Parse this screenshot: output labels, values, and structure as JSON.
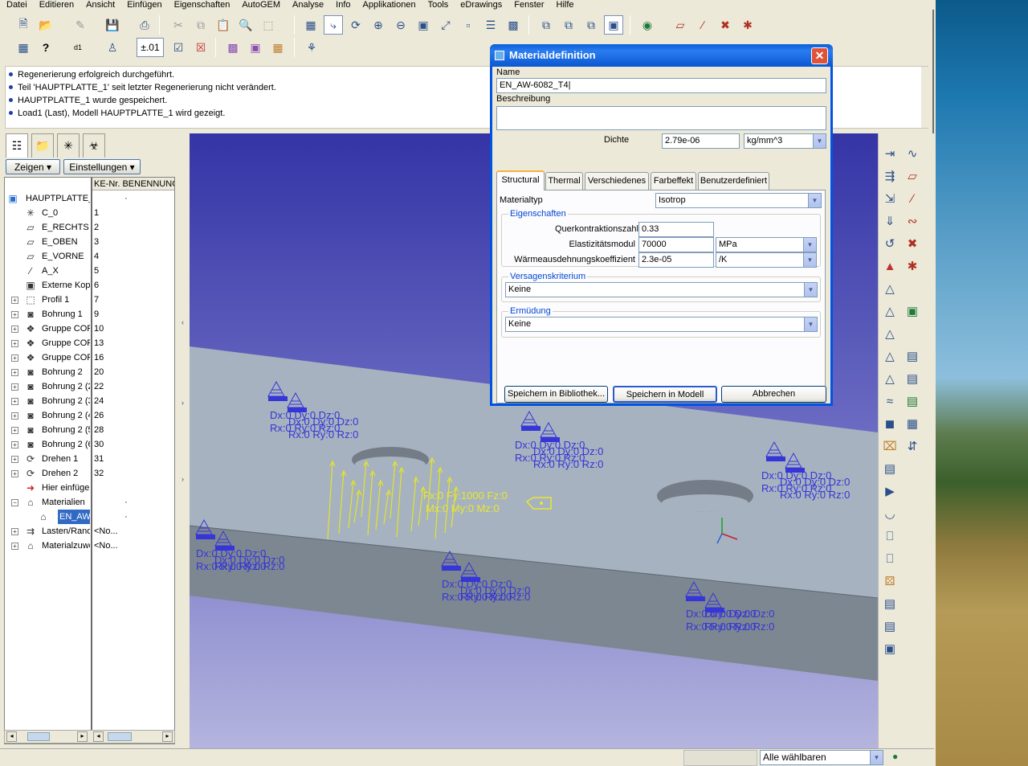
{
  "menu": [
    "Datei",
    "Editieren",
    "Ansicht",
    "Einfügen",
    "Eigenschaften",
    "AutoGEM",
    "Analyse",
    "Info",
    "Applikationen",
    "Tools",
    "eDrawings",
    "Fenster",
    "Hilfe"
  ],
  "toolbar": {
    "precision_label": "±.01"
  },
  "messages": [
    "Regenerierung erfolgreich durchgeführt.",
    "Teil 'HAUPTPLATTE_1' seit letzter Regenerierung nicht verändert.",
    "HAUPTPLATTE_1 wurde gespeichert.",
    "Load1 (Last), Modell HAUPTPLATTE_1 wird gezeigt."
  ],
  "tree": {
    "show_button": "Zeigen",
    "settings_button": "Einstellungen",
    "columns": {
      "ke_nr": "KE-Nr.",
      "name": "BENENNUNG"
    },
    "root": "HAUPTPLATTE_",
    "rows": [
      {
        "name": "C_0",
        "no": "1",
        "icon": "coordinate-system-icon",
        "exp": false
      },
      {
        "name": "E_RECHTS",
        "no": "2",
        "icon": "datum-plane-icon",
        "exp": false
      },
      {
        "name": "E_OBEN",
        "no": "3",
        "icon": "datum-plane-icon",
        "exp": false
      },
      {
        "name": "E_VORNE",
        "no": "4",
        "icon": "datum-plane-icon",
        "exp": false
      },
      {
        "name": "A_X",
        "no": "5",
        "icon": "datum-axis-icon",
        "exp": false
      },
      {
        "name": "Externe Kop",
        "no": "6",
        "icon": "external-copy-icon",
        "exp": false
      },
      {
        "name": "Profil 1",
        "no": "7",
        "icon": "profile-icon",
        "exp": true
      },
      {
        "name": "Bohrung 1",
        "no": "9",
        "icon": "hole-icon",
        "exp": true
      },
      {
        "name": "Gruppe COF",
        "no": "10",
        "icon": "group-icon",
        "exp": true
      },
      {
        "name": "Gruppe COF",
        "no": "13",
        "icon": "group-icon",
        "exp": true
      },
      {
        "name": "Gruppe COF",
        "no": "16",
        "icon": "group-icon",
        "exp": true
      },
      {
        "name": "Bohrung 2",
        "no": "20",
        "icon": "hole-icon",
        "exp": true
      },
      {
        "name": "Bohrung 2 (2",
        "no": "22",
        "icon": "hole-icon",
        "exp": true
      },
      {
        "name": "Bohrung 2 (3",
        "no": "24",
        "icon": "hole-icon",
        "exp": true
      },
      {
        "name": "Bohrung 2 (4",
        "no": "26",
        "icon": "hole-icon",
        "exp": true
      },
      {
        "name": "Bohrung 2 (5",
        "no": "28",
        "icon": "hole-icon",
        "exp": true
      },
      {
        "name": "Bohrung 2 (6",
        "no": "30",
        "icon": "hole-icon",
        "exp": true
      },
      {
        "name": "Drehen 1",
        "no": "31",
        "icon": "revolve-icon",
        "exp": true
      },
      {
        "name": "Drehen 2",
        "no": "32",
        "icon": "revolve-icon",
        "exp": true
      },
      {
        "name": "Hier einfügen",
        "no": "",
        "icon": "insert-here-icon",
        "exp": false
      },
      {
        "name": "Materialien",
        "no": "",
        "icon": "materials-icon",
        "exp": true
      },
      {
        "name": "EN_AW",
        "no": "",
        "icon": "material-tag-icon",
        "exp": false
      },
      {
        "name": "Lasten/Rand",
        "no": "<No...",
        "icon": "loads-icon",
        "exp": true
      },
      {
        "name": "Materialzuwe",
        "no": "<No...",
        "icon": "material-assign-icon",
        "exp": true
      }
    ]
  },
  "dialog": {
    "title": "Materialdefinition",
    "name_label": "Name",
    "name_value": "EN_AW-6082_T4",
    "desc_label": "Beschreibung",
    "desc_value": "",
    "density_label": "Dichte",
    "density_value": "2.79e-06",
    "density_unit": "kg/mm^3",
    "tabs": [
      "Structural",
      "Thermal",
      "Verschiedenes",
      "Farbeffekt",
      "Benutzerdefiniert"
    ],
    "material_type_label": "Materialtyp",
    "material_type_value": "Isotrop",
    "props_group": "Eigenschaften",
    "poisson_label": "Querkontraktionszahl",
    "poisson_value": "0.33",
    "emod_label": "Elastizitätsmodul",
    "emod_value": "70000",
    "emod_unit": "MPa",
    "thermal_label": "Wärmeausdehnungskoeffizient",
    "thermal_value": "2.3e-05",
    "thermal_unit": "/K",
    "failure_group": "Versagenskriterium",
    "failure_value": "Keine",
    "fatigue_group": "Ermüdung",
    "fatigue_value": "Keine",
    "btn_save_lib": "Speichern in Bibliothek...",
    "btn_save_model": "Speichern in Modell",
    "btn_cancel": "Abbrechen"
  },
  "viewport": {
    "constraint_line1": "Dx:0 Dy:0 Dz:0",
    "constraint_line2": "Rx:0 Ry:0 Rz:0",
    "load_line1": "Fx:0 Fy:1000 Fz:0",
    "load_line2": "Mx:0 My:0 Mz:0"
  },
  "status": {
    "filter": "Alle wählbaren"
  },
  "colors": {
    "constraint": "#3535d8",
    "load": "#e8e830",
    "selection": "#316ac5",
    "dialog_title": "#0054e3"
  }
}
